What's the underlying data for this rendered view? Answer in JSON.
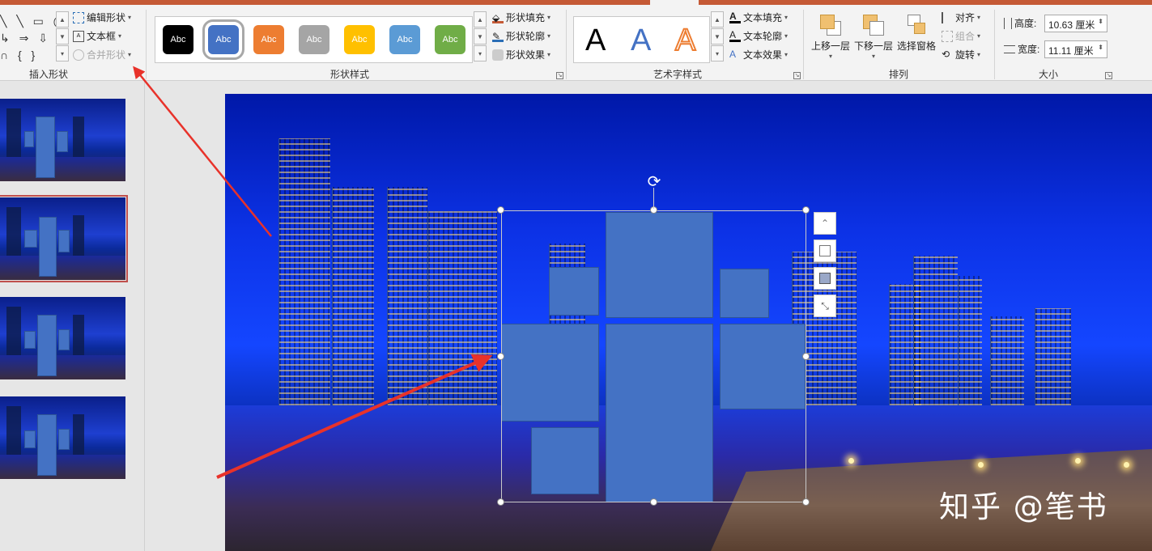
{
  "ribbon": {
    "insert_shapes": {
      "group_label": "插入形状",
      "edit_shape": "编辑形状",
      "text_box": "文本框",
      "merge_shapes": "合并形状"
    },
    "shape_styles": {
      "group_label": "形状样式",
      "swatches": [
        {
          "label": "Abc",
          "color": "#000000"
        },
        {
          "label": "Abc",
          "color": "#4472c4"
        },
        {
          "label": "Abc",
          "color": "#ed7d31"
        },
        {
          "label": "Abc",
          "color": "#a5a5a5"
        },
        {
          "label": "Abc",
          "color": "#ffc000"
        },
        {
          "label": "Abc",
          "color": "#5b9bd5"
        },
        {
          "label": "Abc",
          "color": "#70ad47"
        }
      ],
      "fill": "形状填充",
      "outline": "形状轮廓",
      "effects": "形状效果"
    },
    "wordart": {
      "group_label": "艺术字样式",
      "samples": [
        "A",
        "A",
        "A"
      ],
      "text_fill": "文本填充",
      "text_outline": "文本轮廓",
      "text_effects": "文本效果"
    },
    "arrange": {
      "group_label": "排列",
      "bring_forward": "上移一层",
      "send_backward": "下移一层",
      "selection_pane": "选择窗格",
      "align": "对齐",
      "group": "组合",
      "rotate": "旋转"
    },
    "size": {
      "group_label": "大小",
      "height_label": "高度:",
      "height_value": "10.63 厘米",
      "width_label": "宽度:",
      "width_value": "11.11 厘米"
    }
  },
  "canvas": {
    "watermark": "知乎 @笔书"
  },
  "colors": {
    "accent": "#c55a36",
    "shape_fill": "#4472c4",
    "arrow": "#e8322a"
  },
  "icons": [
    "shape-gallery-icon",
    "edit-shape-icon",
    "text-box-icon",
    "merge-shapes-icon",
    "shape-fill-icon",
    "shape-outline-icon",
    "shape-effects-icon",
    "text-fill-icon",
    "text-outline-icon",
    "text-effects-icon",
    "bring-forward-icon",
    "send-backward-icon",
    "selection-pane-icon",
    "align-icon",
    "group-icon",
    "rotate-icon",
    "height-icon",
    "width-icon",
    "rotate-handle-icon",
    "layout-options-icon"
  ]
}
